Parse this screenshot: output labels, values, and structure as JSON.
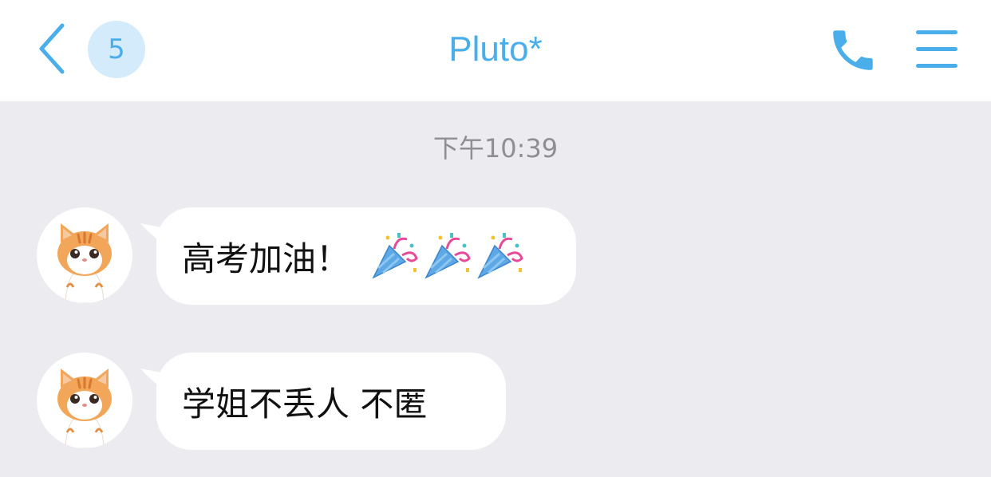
{
  "header": {
    "back_icon": "chevron-left-icon",
    "unread_count": "5",
    "title": "Pluto*",
    "call_icon": "phone-icon",
    "menu_icon": "hamburger-menu-icon",
    "accent_color": "#4aaeea"
  },
  "chat": {
    "timestamp": "下午10:39",
    "messages": [
      {
        "sender_avatar": "orange-tabby-cat-avatar",
        "text": "高考加油！",
        "emoji": [
          "party-popper-icon",
          "party-popper-icon",
          "party-popper-icon"
        ]
      },
      {
        "sender_avatar": "orange-tabby-cat-avatar",
        "text": "学姐不丢人 不匿",
        "emoji": []
      }
    ]
  },
  "colors": {
    "background": "#ebebf0",
    "bubble": "#ffffff",
    "timestamp": "#8e8e93",
    "badge_bg": "#d3ebfa"
  }
}
